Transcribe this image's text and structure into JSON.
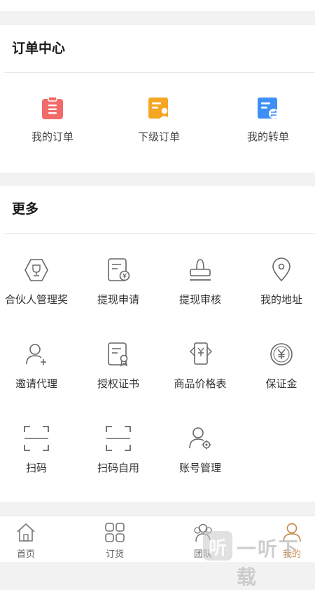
{
  "orders": {
    "title": "订单中心",
    "items": [
      {
        "label": "我的订单",
        "icon": "clipboard-icon",
        "color": "#f26b6b"
      },
      {
        "label": "下级订单",
        "icon": "user-document-icon",
        "color": "#f5a623"
      },
      {
        "label": "我的转单",
        "icon": "transfer-document-icon",
        "color": "#3d8ff5"
      }
    ]
  },
  "more": {
    "title": "更多",
    "items": [
      {
        "label": "合伙人管理奖",
        "icon": "trophy-icon"
      },
      {
        "label": "提现申请",
        "icon": "withdraw-request-icon"
      },
      {
        "label": "提现审核",
        "icon": "stamp-icon"
      },
      {
        "label": "我的地址",
        "icon": "location-pin-icon"
      },
      {
        "label": "邀请代理",
        "icon": "add-user-icon"
      },
      {
        "label": "授权证书",
        "icon": "certificate-icon"
      },
      {
        "label": "商品价格表",
        "icon": "price-list-icon"
      },
      {
        "label": "保证金",
        "icon": "deposit-coin-icon"
      },
      {
        "label": "扫码",
        "icon": "scan-icon"
      },
      {
        "label": "扫码自用",
        "icon": "scan-self-icon"
      },
      {
        "label": "账号管理",
        "icon": "account-settings-icon"
      }
    ]
  },
  "tabbar": {
    "tabs": [
      {
        "label": "首页",
        "icon": "home-icon"
      },
      {
        "label": "订货",
        "icon": "grid-icon"
      },
      {
        "label": "团队",
        "icon": "team-icon"
      },
      {
        "label": "我的",
        "icon": "profile-icon",
        "active": true
      }
    ],
    "active_color": "#c98a4b"
  },
  "watermark": {
    "char": "听",
    "text": "一听下载"
  }
}
